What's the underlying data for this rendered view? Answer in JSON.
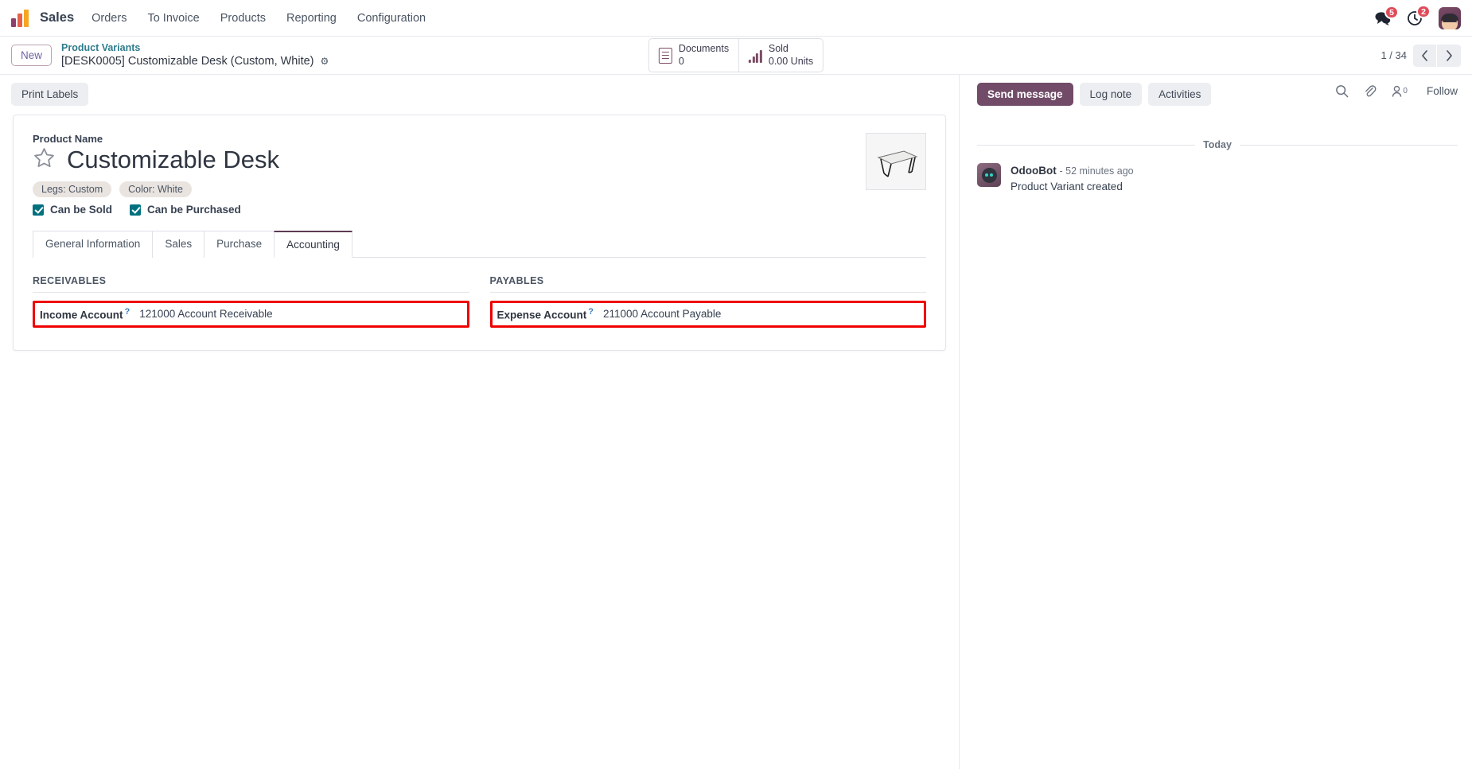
{
  "navbar": {
    "logo_icon": "odoo-bars-logo",
    "app_name": "Sales",
    "menu": [
      {
        "label": "Orders"
      },
      {
        "label": "To Invoice"
      },
      {
        "label": "Products"
      },
      {
        "label": "Reporting"
      },
      {
        "label": "Configuration"
      }
    ],
    "messages_icon": "comments-icon",
    "messages_badge": "5",
    "activities_icon": "clock-icon",
    "activities_badge": "2",
    "avatar_icon": "user-avatar"
  },
  "control_panel": {
    "new_button": "New",
    "breadcrumb_parent": "Product Variants",
    "breadcrumb_current": "[DESK0005] Customizable Desk (Custom, White)",
    "gear_icon": "gear-icon",
    "stat_buttons": [
      {
        "icon": "document-icon",
        "label": "Documents",
        "value": "0"
      },
      {
        "icon": "bar-chart-icon",
        "label": "Sold",
        "value": "0.00 Units"
      }
    ],
    "pager_text": "1 / 34",
    "pager_prev_icon": "chevron-left-icon",
    "pager_next_icon": "chevron-right-icon"
  },
  "statusbar": {
    "print_labels": "Print Labels"
  },
  "form": {
    "product_name_label": "Product Name",
    "product_name": "Customizable Desk",
    "star_icon": "star-outline-icon",
    "tags": [
      {
        "label": "Legs: Custom"
      },
      {
        "label": "Color: White"
      }
    ],
    "checkboxes": [
      {
        "label": "Can be Sold",
        "checked": true
      },
      {
        "label": "Can be Purchased",
        "checked": true
      }
    ],
    "product_image_icon": "desk-product-image",
    "tabs": [
      {
        "label": "General Information",
        "active": false
      },
      {
        "label": "Sales",
        "active": false
      },
      {
        "label": "Purchase",
        "active": false
      },
      {
        "label": "Accounting",
        "active": true
      }
    ],
    "accounting": {
      "receivables": {
        "title": "RECEIVABLES",
        "income_account_label": "Income Account",
        "income_account_help": "?",
        "income_account_value": "121000 Account Receivable"
      },
      "payables": {
        "title": "PAYABLES",
        "expense_account_label": "Expense Account",
        "expense_account_help": "?",
        "expense_account_value": "211000 Account Payable"
      }
    }
  },
  "chatter": {
    "send_message": "Send message",
    "log_note": "Log note",
    "activities": "Activities",
    "search_icon": "search-icon",
    "attachment_icon": "paperclip-icon",
    "followers_icon": "user-icon",
    "followers_count": "0",
    "follow_label": "Follow",
    "date_divider": "Today",
    "messages": [
      {
        "avatar_icon": "odoobot-avatar",
        "author": "OdooBot",
        "time": "- 52 minutes ago",
        "text": "Product Variant created"
      }
    ]
  },
  "colors": {
    "brand_purple": "#714b67",
    "teal_checkbox": "#00707f",
    "highlight_red": "#ee0000",
    "breadcrumb_teal": "#2e7b8c",
    "badge_red": "#e04b59"
  }
}
